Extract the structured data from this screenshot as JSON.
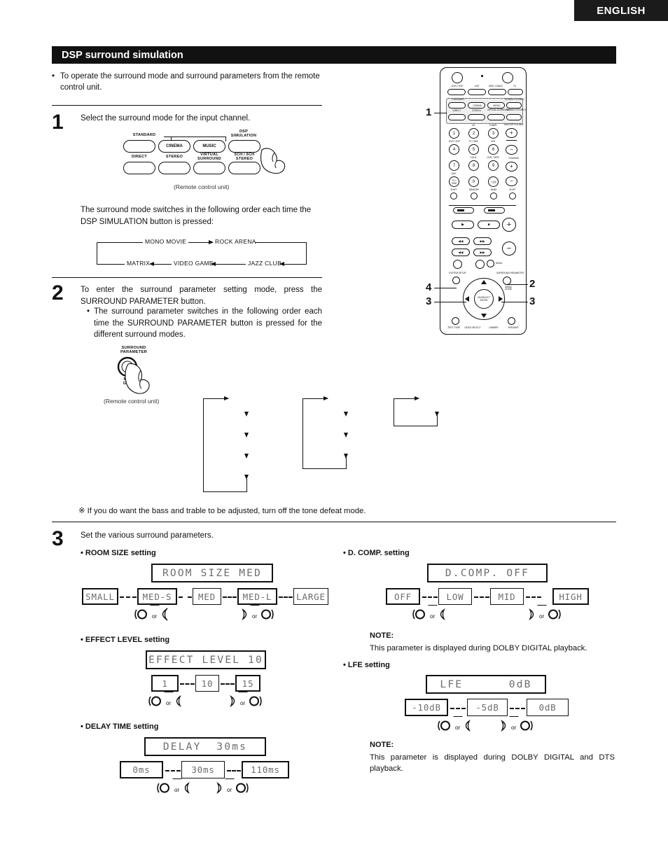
{
  "page": {
    "language_tab": "ENGLISH",
    "section_title": "DSP surround simulation"
  },
  "intro": {
    "bullet": "•",
    "text": "To operate the surround mode and surround parameters from the remote control unit."
  },
  "steps": [
    {
      "number": "1",
      "text": "Select the surround mode for the input channel.",
      "caption": "(Remote control unit)",
      "buttons": {
        "group_label": "STANDARD",
        "top_row": [
          "",
          "CINEMA",
          "MUSIC",
          ""
        ],
        "top_row_outer_labels": [
          "",
          "",
          "",
          "DSP\nSIMULATION"
        ],
        "bottom_labels": [
          "DIRECT",
          "STEREO",
          "VIRTUAL\nSURROUND",
          "5CH / 6CH\nSTEREO"
        ]
      },
      "order_text": "The surround mode switches in the following order each time the DSP SIMULATION button is pressed:",
      "order_flow_top": [
        "MONO MOVIE",
        "ROCK ARENA"
      ],
      "order_flow_bottom": [
        "MATRIX",
        "VIDEO GAME",
        "JAZZ CLUB"
      ]
    },
    {
      "number": "2",
      "text": "To enter the surround parameter setting mode, press the SURROUND PARAMETER button.",
      "sub_bullet": "•",
      "sub_text": "The surround parameter switches in the following order each time the SURROUND PARAMETER button is pressed for the different surround modes.",
      "knob_label": "SURROUND\nPARAMETER",
      "knob_sub": "MENU\nGUIDE",
      "caption": "(Remote control unit)"
    },
    {
      "number": "3",
      "text": "Set the various surround parameters."
    }
  ],
  "tone_note": {
    "mark": "※",
    "text": "If you do want the bass and trable to be adjusted, turn off the tone defeat mode."
  },
  "parameters": {
    "left": [
      {
        "heading": "• ROOM SIZE setting",
        "display": "ROOM SIZE MED",
        "options": [
          "SMALL",
          "MED-S",
          "MED",
          "MED-L",
          "LARGE"
        ],
        "bold_options": [
          "SMALL",
          "MED-S",
          "MED-L"
        ]
      },
      {
        "heading": "• EFFECT LEVEL setting",
        "display": "EFFECT LEVEL 10",
        "options": [
          "1",
          "10",
          "15"
        ],
        "bold_options": [
          "1",
          "15"
        ]
      },
      {
        "heading": "• DELAY TIME setting",
        "display": "DELAY  30ms",
        "options": [
          "0ms",
          "30ms",
          "110ms"
        ],
        "bold_options": [
          "0ms",
          "110ms"
        ]
      }
    ],
    "right": [
      {
        "heading": "• D. COMP. setting",
        "display": "D.COMP. OFF",
        "options": [
          "OFF",
          "LOW",
          "MID",
          "HIGH"
        ],
        "bold_options": [
          "OFF",
          "HIGH"
        ],
        "note_heading": "NOTE:",
        "note_text": "This parameter is displayed during DOLBY DIGITAL playback."
      },
      {
        "heading": "• LFE setting",
        "display": "LFE      0dB",
        "options": [
          "-10dB",
          "-5dB",
          "0dB"
        ],
        "bold_options": [
          "-10dB"
        ],
        "note_heading": "NOTE:",
        "note_text": "This parameter is displayed during DOLBY DIGITAL and DTS playback."
      }
    ],
    "or_label": "or"
  },
  "remote": {
    "callouts": [
      "1",
      "2",
      "3",
      "3",
      "4"
    ],
    "top_buttons": [
      "DVD / VDP",
      "VCR",
      "DBS / CABLE",
      "TV"
    ],
    "mode_buttons_top": [
      "",
      "CINEMA",
      "MUSIC",
      "5CH/6CH STEREO"
    ],
    "mode_group_label": "STANDARD",
    "mode_buttons_bottom": [
      "DIRECT",
      "STEREO",
      "VIRTUAL SURROUND",
      "5CH/6CH STEREO"
    ],
    "numeric_keys": [
      "1",
      "2",
      "3",
      "4",
      "5",
      "6",
      "7",
      "8",
      "9",
      "TV / DBS",
      "0",
      "+10"
    ],
    "key_sub_labels": [
      "",
      "CD",
      "TUNER",
      "DVD / VDP",
      "TV / DBS",
      "VCR",
      "",
      "V.AUX",
      "CDR / TAPE",
      "AUX",
      "",
      ""
    ],
    "volume_label": "MASTER VOLUME",
    "channel_label": "CHANNEL",
    "lower_keys": [
      "SHIFT",
      "MEMORY",
      "BAND",
      "SHIFT"
    ],
    "transport": [
      "▶",
      "■",
      "◀◀",
      "▶▶",
      "◀◀",
      "▶▶"
    ],
    "menu_label": "MENU",
    "surround_param_label": "SURROUND PARAMETER",
    "select_label": "ON / SELECT ENTER",
    "system_setup_label": "SYSTEM SETUP",
    "bottom_labels": [
      "TEST TONE",
      "VIDEO SELECT",
      "DIMMER",
      "SPEAKER"
    ]
  }
}
